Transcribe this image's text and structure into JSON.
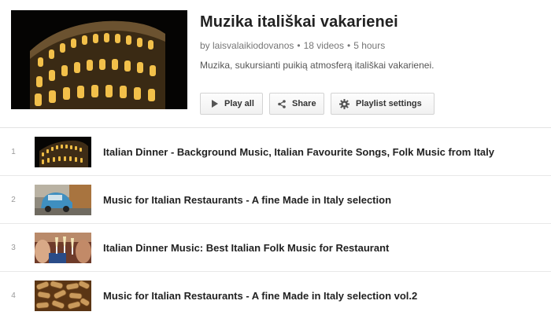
{
  "playlist": {
    "title": "Muzika itališkai vakarienei",
    "owner": "by laisvalaikiodovanos",
    "video_count": "18 videos",
    "duration": "5 hours",
    "meta_separator": "•",
    "description": "Muzika, sukursianti puikią atmosferą itališkai vakarienei.",
    "thumbnail": "colosseum-night-photo"
  },
  "actions": {
    "play_all": "Play all",
    "share": "Share",
    "settings": "Playlist settings",
    "play_icon": "play-icon",
    "share_icon": "share-icon",
    "settings_icon": "gear-icon"
  },
  "videos": [
    {
      "index": "1",
      "title": "Italian Dinner - Background Music, Italian Favourite Songs, Folk Music from Italy",
      "thumbnail": "colosseum-night-photo"
    },
    {
      "index": "2",
      "title": "Music for Italian Restaurants - A fine Made in Italy selection",
      "thumbnail": "blue-fiat-car-photo"
    },
    {
      "index": "3",
      "title": "Italian Dinner Music: Best Italian Folk Music for Restaurant",
      "thumbnail": "wine-toast-photo"
    },
    {
      "index": "4",
      "title": "Music for Italian Restaurants - A fine Made in Italy selection vol.2",
      "thumbnail": "wine-corks-photo"
    }
  ]
}
